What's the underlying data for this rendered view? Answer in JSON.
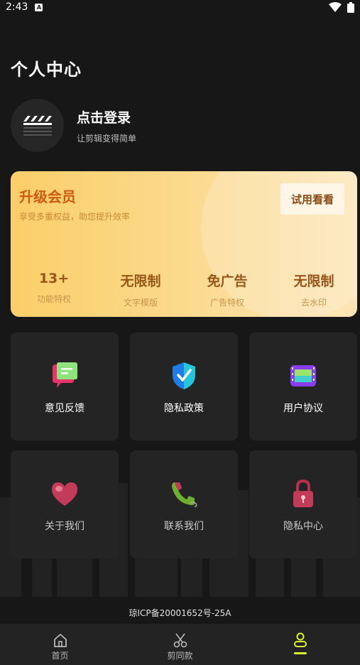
{
  "status_bar": {
    "time": "2:43",
    "notification_badge": "A"
  },
  "page": {
    "title": "个人中心"
  },
  "profile": {
    "login_title": "点击登录",
    "login_subtitle": "让剪辑变得简单",
    "avatar_icon": "clapperboard-icon"
  },
  "vip": {
    "title": "升级会员",
    "subtitle": "享受多重权益，助您提升效率",
    "trial_button": "试用看看",
    "perks": [
      {
        "value": "13+",
        "label": "功能特权"
      },
      {
        "value": "无限制",
        "label": "文字模版"
      },
      {
        "value": "免广告",
        "label": "广告特权"
      },
      {
        "value": "无限制",
        "label": "去水印"
      }
    ]
  },
  "tiles": [
    {
      "label": "意见反馈",
      "icon": "feedback-bubble-icon"
    },
    {
      "label": "隐私政策",
      "icon": "shield-check-icon"
    },
    {
      "label": "用户协议",
      "icon": "film-strip-icon"
    },
    {
      "label": "关于我们",
      "icon": "heart-icon"
    },
    {
      "label": "联系我们",
      "icon": "phone-icon"
    },
    {
      "label": "隐私中心",
      "icon": "lock-icon"
    }
  ],
  "footer": {
    "icp": "琼ICP备20001652号-25A"
  },
  "bottom_nav": [
    {
      "label": "首页",
      "icon": "home-icon"
    },
    {
      "label": "剪同款",
      "icon": "scissors-icon"
    },
    {
      "label": "",
      "icon": "profile-icon"
    }
  ],
  "colors": {
    "accent": "#d9f230",
    "vip_title": "#cf5a12",
    "background": "#171717"
  }
}
